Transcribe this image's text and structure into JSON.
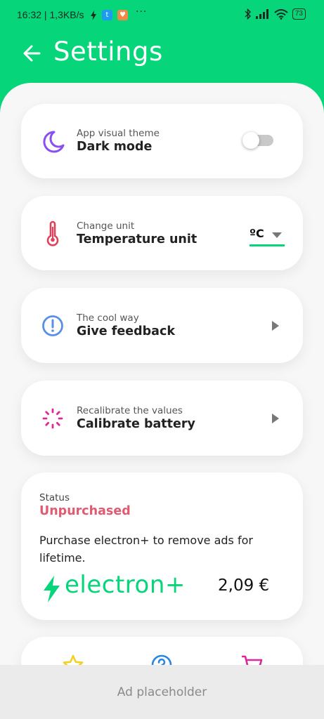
{
  "status_bar": {
    "time_speed": "16:32 | 1,3KB/s",
    "dots": "···",
    "battery": "73",
    "icons": [
      "flash-icon",
      "twitter-icon",
      "heart-app-icon",
      "bluetooth-icon",
      "signal-icon",
      "wifi-icon",
      "battery-icon"
    ]
  },
  "header": {
    "title": "Settings",
    "back_icon": "arrow-left-icon"
  },
  "settings": {
    "dark_mode": {
      "sub": "App visual theme",
      "main": "Dark mode",
      "icon": "moon-icon",
      "enabled": false
    },
    "temperature": {
      "sub": "Change unit",
      "main": "Temperature unit",
      "icon": "thermometer-icon",
      "value": "ºC"
    },
    "feedback": {
      "sub": "The cool way",
      "main": "Give feedback",
      "icon": "exclamation-circle-icon"
    },
    "calibrate": {
      "sub": "Recalibrate the values",
      "main": "Calibrate battery",
      "icon": "spinner-icon"
    }
  },
  "purchase": {
    "status_label": "Status",
    "status_value": "Unpurchased",
    "description": "Purchase electron+ to remove ads for lifetime.",
    "brand": "electron+",
    "price": "2,09 €"
  },
  "bottom_icons": [
    "star-icon",
    "help-icon",
    "cart-icon"
  ],
  "ad": {
    "label": "Ad placeholder"
  },
  "colors": {
    "accent": "#06d57a",
    "status_red": "#e05a72",
    "moon": "#8b4ef0",
    "thermo": "#e0405a",
    "info": "#5a8fe8",
    "spinner": "#e0279a"
  }
}
